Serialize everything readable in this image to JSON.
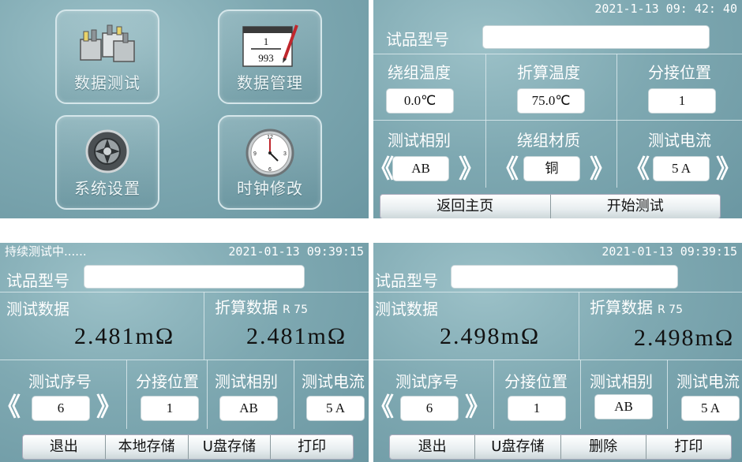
{
  "menu": {
    "tiles": [
      {
        "label": "数据测试",
        "icon": "transformer-icon"
      },
      {
        "label": "数据管理",
        "icon": "notepad-icon",
        "num": "1",
        "den": "993"
      },
      {
        "label": "系统设置",
        "icon": "gear-icon"
      },
      {
        "label": "时钟修改",
        "icon": "clock-icon"
      }
    ]
  },
  "setup": {
    "datetime": "2021-1-13 09: 42: 40",
    "model_label": "试品型号",
    "model_value": "",
    "winding_temp_label": "绕组温度",
    "winding_temp_value": "0.0℃",
    "conv_temp_label": "折算温度",
    "conv_temp_value": "75.0℃",
    "tap_label": "分接位置",
    "tap_value": "1",
    "phase_label": "测试相别",
    "phase_value": "AB",
    "material_label": "绕组材质",
    "material_value": "铜",
    "current_label": "测试电流",
    "current_value": "5 A",
    "left_arrow": "《",
    "right_arrow": "》",
    "back_label": "返回主页",
    "start_label": "开始测试"
  },
  "run": {
    "status": "持续测试中......",
    "datetime": "2021-01-13 09:39:15",
    "model_label": "试品型号",
    "model_value": "",
    "test_data_label": "测试数据",
    "test_value": "2.481mΩ",
    "conv_data_label": "折算数据",
    "conv_sub": "R 75",
    "conv_value": "2.481mΩ",
    "seq_label": "测试序号",
    "seq_value": "6",
    "tap_label": "分接位置",
    "tap_value": "1",
    "phase_label": "测试相别",
    "phase_value": "AB",
    "current_label": "测试电流",
    "current_value": "5 A",
    "buttons": [
      "退出",
      "本地存储",
      "U盘存储",
      "打印"
    ]
  },
  "result": {
    "datetime": "2021-01-13 09:39:15",
    "model_label": "试品型号",
    "model_value": "",
    "test_data_label": "测试数据",
    "test_value": "2.498mΩ",
    "conv_data_label": "折算数据",
    "conv_sub": "R 75",
    "conv_value": "2.498mΩ",
    "seq_label": "测试序号",
    "seq_value": "6",
    "tap_label": "分接位置",
    "tap_value": "1",
    "phase_label": "测试相别",
    "phase_value": "AB",
    "current_label": "测试电流",
    "current_value": "5 A",
    "buttons": [
      "退出",
      "U盘存储",
      "删除",
      "打印"
    ]
  }
}
